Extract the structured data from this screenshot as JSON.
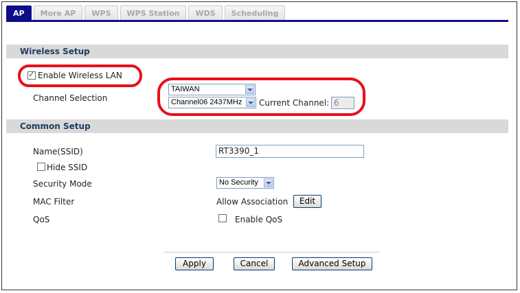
{
  "tabs": [
    {
      "label": "AP",
      "active": true
    },
    {
      "label": "More AP"
    },
    {
      "label": "WPS"
    },
    {
      "label": "WPS Station"
    },
    {
      "label": "WDS"
    },
    {
      "label": "Scheduling"
    }
  ],
  "wireless_setup": {
    "title": "Wireless Setup",
    "enable_wireless_label": "Enable Wireless LAN",
    "enable_wireless_checked": true,
    "channel_selection_label": "Channel Selection",
    "region_value": "TAIWAN",
    "channel_value": "Channel06 2437MHz",
    "current_channel_label": "Current Channel:",
    "current_channel_value": "6"
  },
  "common_setup": {
    "title": "Common Setup",
    "ssid_label": "Name(SSID)",
    "ssid_value": "RT3390_1",
    "hide_ssid_label": "Hide SSID",
    "security_mode_label": "Security Mode",
    "security_mode_value": "No Security",
    "mac_filter_label": "MAC Filter",
    "mac_filter_value": "Allow Association",
    "edit_label": "Edit",
    "qos_label": "QoS",
    "enable_qos_label": "Enable QoS"
  },
  "buttons": {
    "apply": "Apply",
    "cancel": "Cancel",
    "advanced": "Advanced Setup"
  },
  "colors": {
    "highlight_ring": "#e8101a",
    "active_tab": "#0e0e8a",
    "section_bg": "#d9d9d9"
  }
}
